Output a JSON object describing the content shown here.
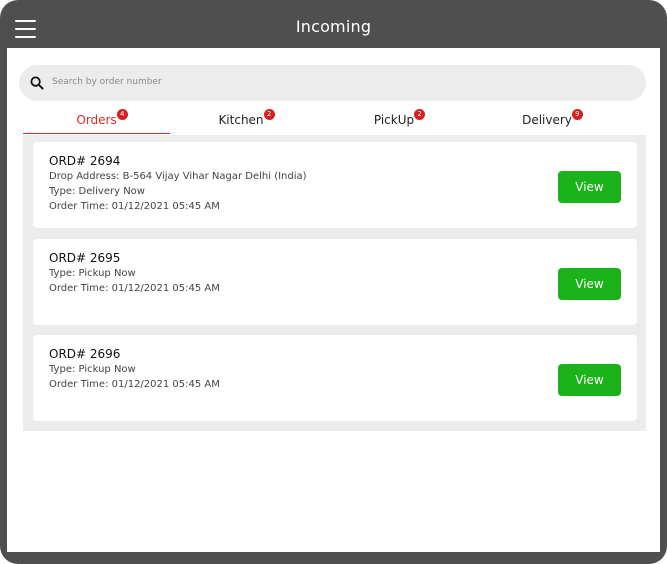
{
  "header": {
    "title": "Incoming"
  },
  "search": {
    "placeholder": "Search by order number"
  },
  "tabs": [
    {
      "label": "Orders",
      "badge": "4",
      "active": true
    },
    {
      "label": "Kitchen",
      "badge": "2",
      "active": false
    },
    {
      "label": "PickUp",
      "badge": "2",
      "active": false
    },
    {
      "label": "Delivery",
      "badge": "9",
      "active": false
    }
  ],
  "orders": [
    {
      "id": "ORD# 2694",
      "lines": [
        "Drop Address: B-564 Vijay Vihar Nagar Delhi (India)",
        "Type: Delivery Now",
        "Order Time: 01/12/2021 05:45 AM"
      ],
      "button": "View"
    },
    {
      "id": "ORD# 2695",
      "lines": [
        "Type: Pickup Now",
        "Order Time: 01/12/2021 05:45 AM"
      ],
      "button": "View"
    },
    {
      "id": "ORD# 2696",
      "lines": [
        "Type: Pickup Now",
        "Order Time: 01/12/2021 05:45 AM"
      ],
      "button": "View"
    }
  ],
  "colors": {
    "frame": "#4f4f4f",
    "accent": "#d92b2b",
    "badge": "#d81e1e",
    "view_button": "#1bb21b",
    "list_bg": "#ececec"
  }
}
